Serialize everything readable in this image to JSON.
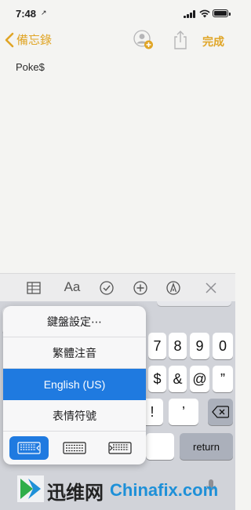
{
  "status_bar": {
    "time": "7:48",
    "location_glyph": "↗"
  },
  "nav": {
    "back_label": "備忘錄",
    "done_label": "完成",
    "icons": [
      "add-person-icon",
      "share-icon"
    ]
  },
  "note": {
    "text": "Poke$"
  },
  "format_toolbar": {
    "text_style_label": "Aa",
    "icons": [
      "table-icon",
      "text-style-icon",
      "checklist-icon",
      "add-icon",
      "markup-icon",
      "close-icon"
    ]
  },
  "keyboard_popup": {
    "items": [
      {
        "label": "鍵盤設定⋯",
        "selected": false
      },
      {
        "label": "繁體注音",
        "selected": false
      },
      {
        "label": "English (US)",
        "selected": true
      },
      {
        "label": "表情符號",
        "selected": false
      }
    ],
    "layout_icons": [
      "left-keyboard-icon",
      "full-keyboard-icon",
      "right-keyboard-icon"
    ],
    "selected_color": "#1f7ae0"
  },
  "keyboard": {
    "row1": [
      "7",
      "8",
      "9",
      "0"
    ],
    "row2": [
      "$",
      "&",
      "@",
      "”"
    ],
    "row3": [
      "!",
      "’"
    ],
    "return_label": "return",
    "backspace_icon": "backspace-icon"
  },
  "watermark": {
    "cn_text": "迅维网",
    "en_text": "Chinafix.com"
  },
  "colors": {
    "accent": "#e0a526",
    "selection": "#1f7ae0"
  }
}
